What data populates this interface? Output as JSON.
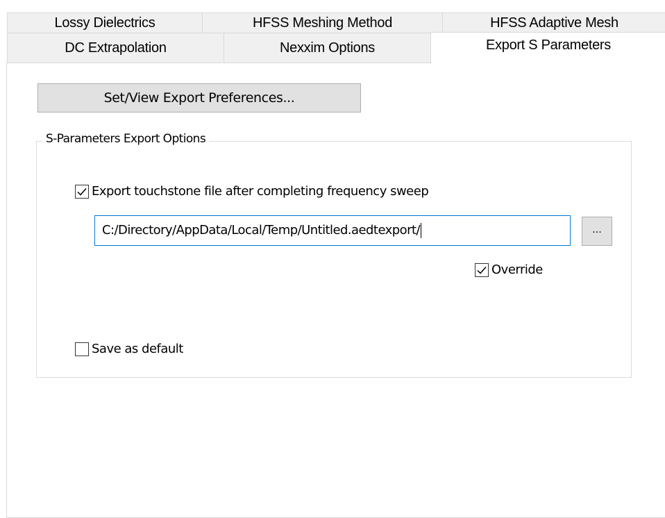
{
  "tabs": {
    "row1": [
      "Lossy Dielectrics",
      "HFSS Meshing Method",
      "HFSS Adaptive Mesh"
    ],
    "row2": [
      "DC Extrapolation",
      "Nexxim Options",
      "Export S Parameters"
    ],
    "active": "Export S Parameters"
  },
  "preferences_button": "Set/View Export Preferences...",
  "group": {
    "title": "S-Parameters Export Options",
    "export_touchstone": {
      "label": "Export touchstone file after completing frequency sweep",
      "checked": true
    },
    "path_value": "C:/Directory/AppData/Local/Temp/Untitled.aedtexport/",
    "browse_label": "...",
    "override": {
      "label": "Override",
      "checked": true
    },
    "save_default": {
      "label": "Save as default",
      "checked": false
    }
  },
  "colors": {
    "tab_bg": "#f0f0f0",
    "border": "#d9d9d9",
    "input_focus": "#0078d7",
    "button_bg": "#e1e1e1"
  }
}
